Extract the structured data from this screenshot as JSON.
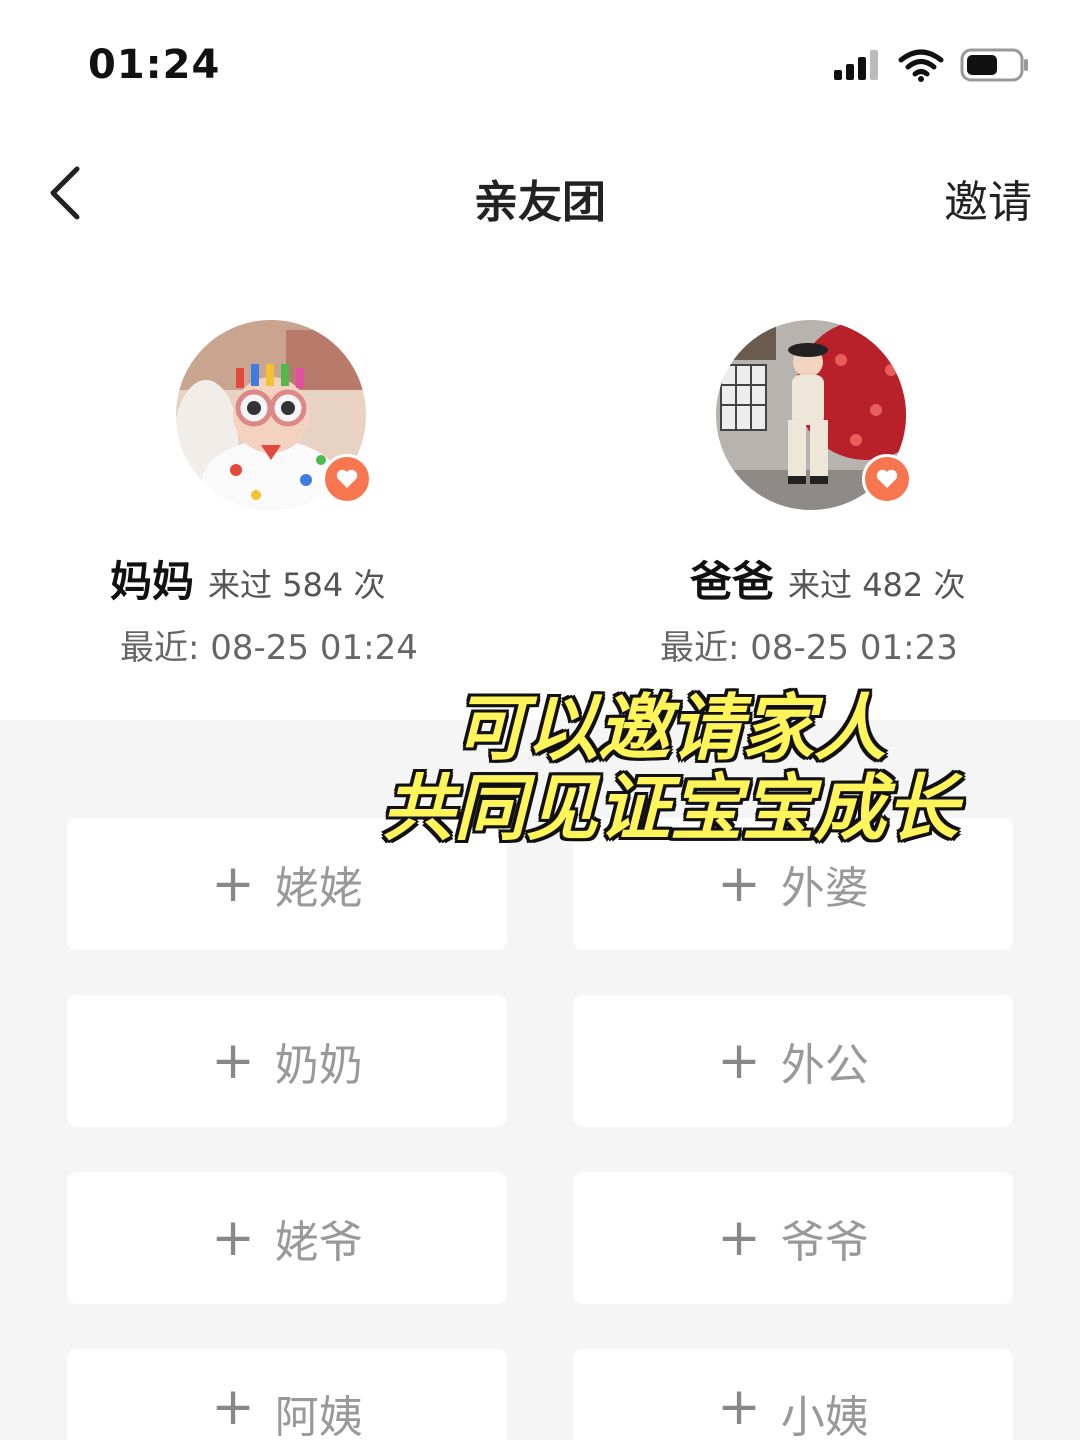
{
  "status_bar": {
    "time": "01:24"
  },
  "nav": {
    "title": "亲友团",
    "invite_label": "邀请"
  },
  "members": [
    {
      "name": "妈妈",
      "visits": "来过 584 次",
      "recent": "最近: 08-25 01:24"
    },
    {
      "name": "爸爸",
      "visits": "来过 482 次",
      "recent": "最近: 08-25 01:23"
    }
  ],
  "slots": [
    {
      "plus": "+",
      "label": "姥姥"
    },
    {
      "plus": "+",
      "label": "外婆"
    },
    {
      "plus": "+",
      "label": "奶奶"
    },
    {
      "plus": "+",
      "label": "外公"
    },
    {
      "plus": "+",
      "label": "姥爷"
    },
    {
      "plus": "+",
      "label": "爷爷"
    },
    {
      "plus": "+",
      "label": "阿姨"
    },
    {
      "plus": "+",
      "label": "小姨"
    }
  ],
  "caption": {
    "line1": "可以邀请家人",
    "line2": "共同见证宝宝成长"
  },
  "colors": {
    "accent": "#f7764f",
    "caption": "#fff45a"
  }
}
